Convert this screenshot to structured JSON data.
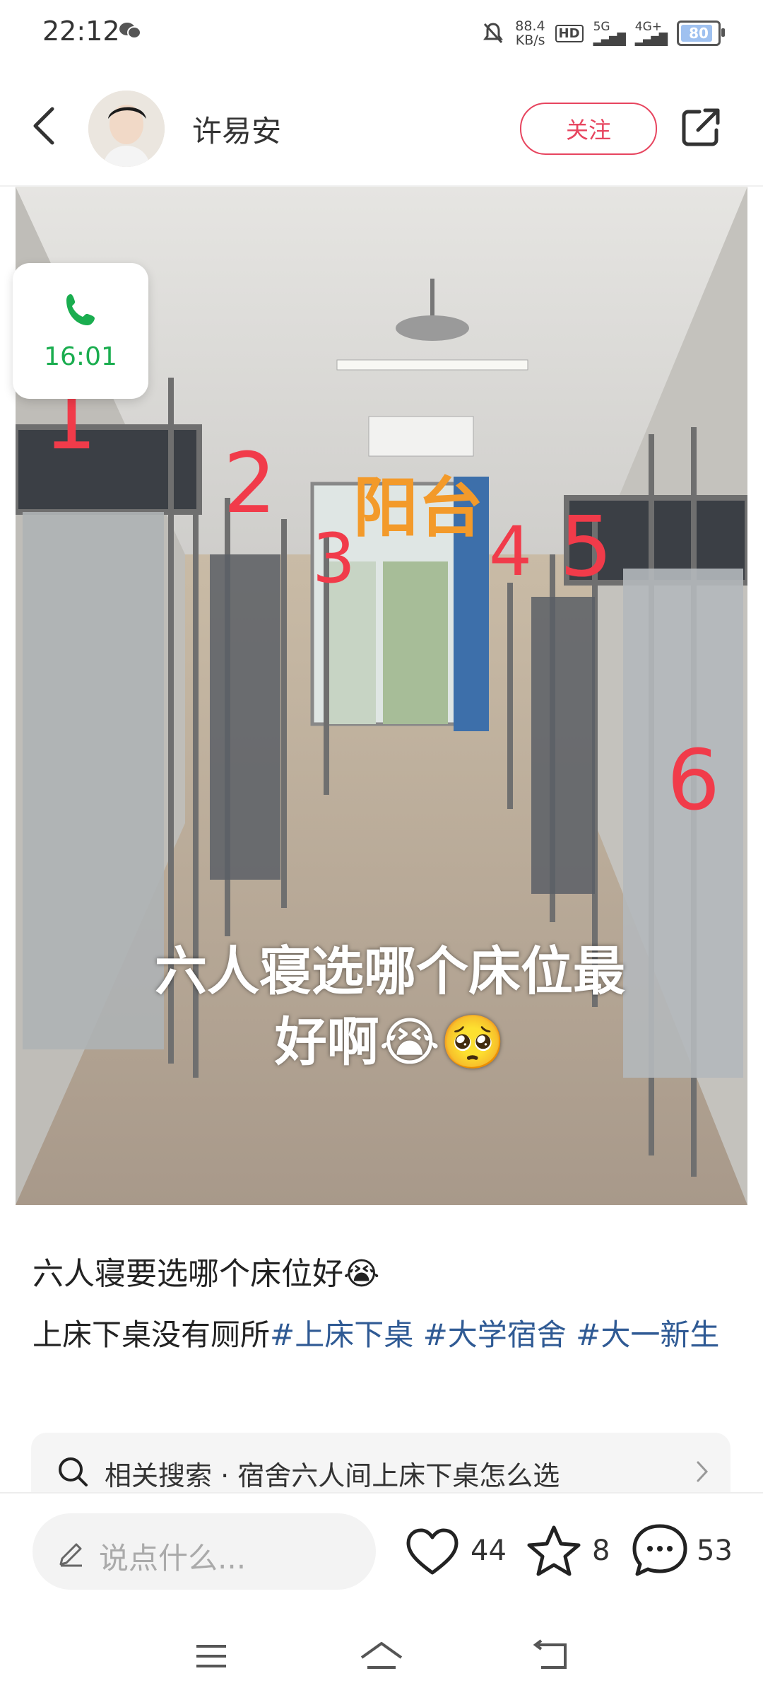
{
  "status_bar": {
    "time": "22:12",
    "net_speed_value": "88.4",
    "net_speed_unit": "KB/s",
    "hd_label": "HD",
    "sig1_label": "5G",
    "sig2_label": "4G+",
    "battery": "80"
  },
  "header": {
    "author_name": "许易安",
    "follow_label": "关注"
  },
  "call_bubble": {
    "time": "16:01"
  },
  "photo": {
    "overlay_line1": "六人寝选哪个床位最",
    "overlay_line2": "好啊😭🥺",
    "numbers": [
      "1",
      "2",
      "3",
      "4",
      "5",
      "6"
    ],
    "balcony_label": "阳台"
  },
  "post": {
    "title": "六人寝要选哪个床位好😭",
    "desc_text": "上床下桌没有厕所",
    "tags": [
      "#上床下桌",
      "#大学宿舍",
      "#大一新生"
    ]
  },
  "related_search": {
    "text": "相关搜索 · 宿舍六人间上床下桌怎么选"
  },
  "bottom_bar": {
    "comment_placeholder": "说点什么...",
    "likes": "44",
    "favorites": "8",
    "comments": "53"
  },
  "colors": {
    "accent": "#e7455f",
    "tag": "#2f5a94",
    "call_green": "#1aad4f"
  }
}
